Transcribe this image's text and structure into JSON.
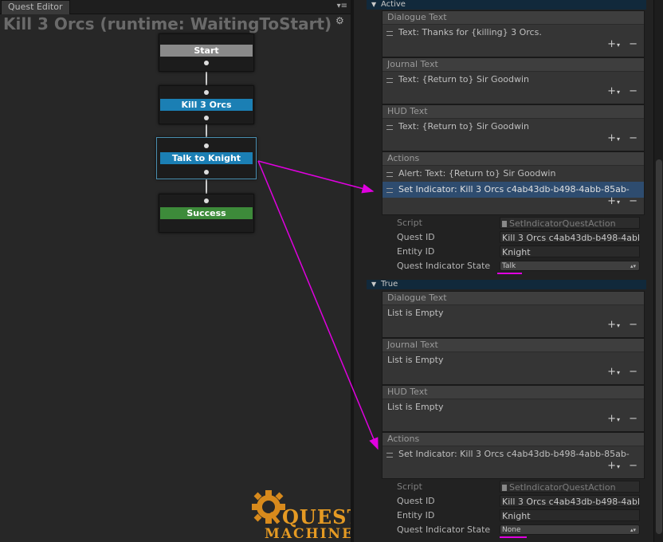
{
  "window": {
    "tab_label": "Quest Editor",
    "title": "Kill 3 Orcs (runtime: WaitingToStart)"
  },
  "nodes": [
    {
      "label": "Start",
      "header_color": "#8a8a8a"
    },
    {
      "label": "Kill 3 Orcs",
      "header_color": "#1b7fb4"
    },
    {
      "label": "Talk to Knight",
      "header_color": "#1b7fb4"
    },
    {
      "label": "Success",
      "header_color": "#3d8b3a"
    }
  ],
  "logo": {
    "line1": "QUEST",
    "line2": "MACHINE"
  },
  "inspector": {
    "active": {
      "header": "Active",
      "dialogue": {
        "title": "Dialogue Text",
        "items": [
          "Text: Thanks for {killing} 3 Orcs."
        ]
      },
      "journal": {
        "title": "Journal Text",
        "items": [
          "Text: {Return to} Sir Goodwin"
        ]
      },
      "hud": {
        "title": "HUD Text",
        "items": [
          "Text: {Return to} Sir Goodwin"
        ]
      },
      "actions": {
        "title": "Actions",
        "items": [
          "Alert: Text: {Return to} Sir Goodwin",
          "Set Indicator: Kill 3 Orcs c4ab43db-b498-4abb-85ab-"
        ]
      },
      "details": {
        "script_label": "Script",
        "script_value": "SetIndicatorQuestAction",
        "quest_id_label": "Quest ID",
        "quest_id_value": "Kill 3 Orcs c4ab43db-b498-4abb",
        "entity_id_label": "Entity ID",
        "entity_id_value": "Knight",
        "state_label": "Quest Indicator State",
        "state_value": "Talk"
      }
    },
    "true": {
      "header": "True",
      "dialogue": {
        "title": "Dialogue Text",
        "empty": "List is Empty"
      },
      "journal": {
        "title": "Journal Text",
        "empty": "List is Empty"
      },
      "hud": {
        "title": "HUD Text",
        "empty": "List is Empty"
      },
      "actions": {
        "title": "Actions",
        "items": [
          "Set Indicator: Kill 3 Orcs c4ab43db-b498-4abb-85ab-"
        ]
      },
      "details": {
        "script_label": "Script",
        "script_value": "SetIndicatorQuestAction",
        "quest_id_label": "Quest ID",
        "quest_id_value": "Kill 3 Orcs c4ab43db-b498-4abb",
        "entity_id_label": "Entity ID",
        "entity_id_value": "Knight",
        "state_label": "Quest Indicator State",
        "state_value": "None"
      }
    }
  },
  "colors": {
    "annotation": "#e000e0",
    "selection": "#2e4c6f",
    "section_header": "#11293b"
  }
}
